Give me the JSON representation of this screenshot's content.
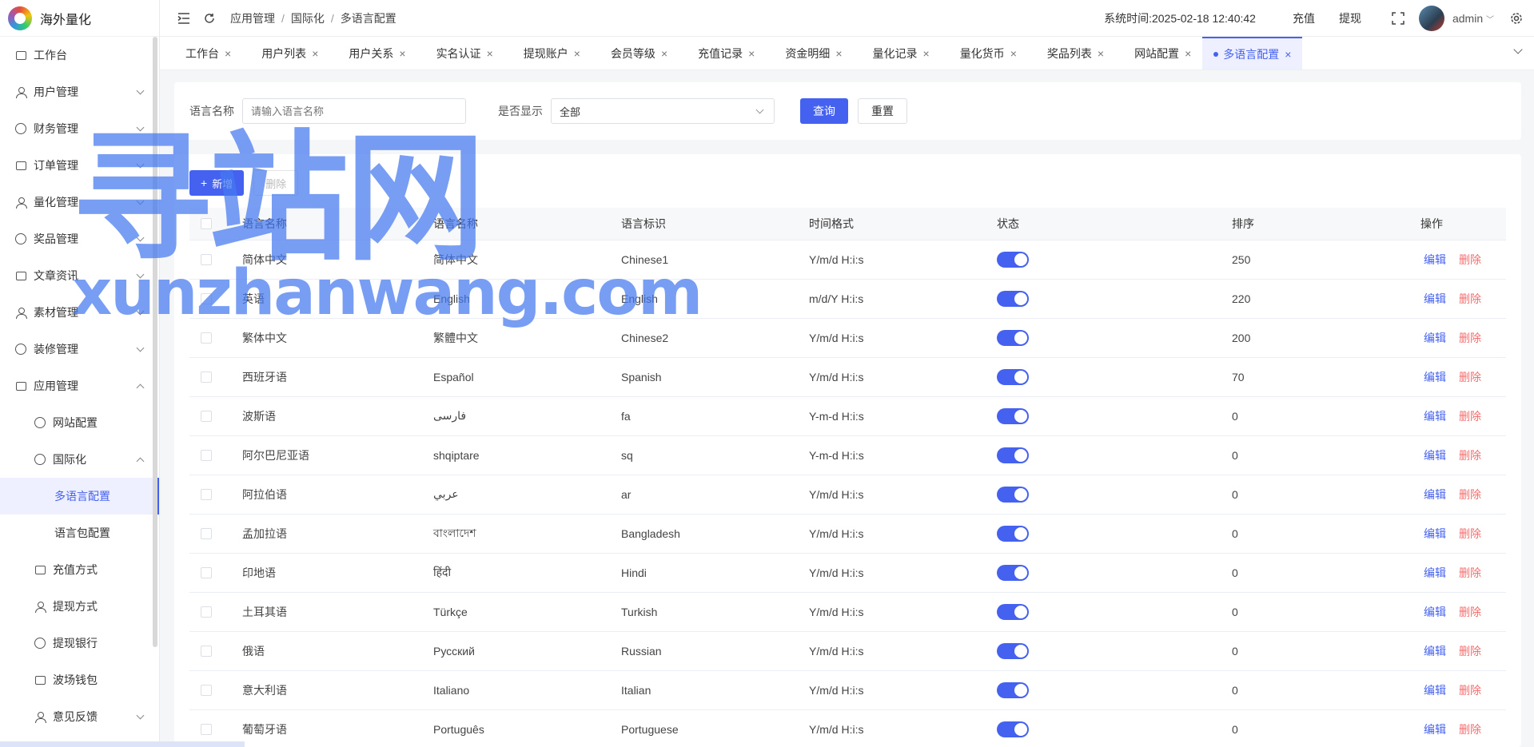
{
  "app": {
    "title": "海外量化"
  },
  "sidebar": {
    "items": [
      {
        "label": "工作台",
        "icon": "monitor-icon",
        "expandable": false
      },
      {
        "label": "用户管理",
        "icon": "user-icon",
        "expandable": true
      },
      {
        "label": "财务管理",
        "icon": "chart-icon",
        "expandable": true
      },
      {
        "label": "订单管理",
        "icon": "order-icon",
        "expandable": true
      },
      {
        "label": "量化管理",
        "icon": "quant-icon",
        "expandable": true
      },
      {
        "label": "奖品管理",
        "icon": "gift-icon",
        "expandable": true
      },
      {
        "label": "文章资讯",
        "icon": "article-icon",
        "expandable": true
      },
      {
        "label": "素材管理",
        "icon": "image-icon",
        "expandable": true
      },
      {
        "label": "装修管理",
        "icon": "decorate-icon",
        "expandable": true
      },
      {
        "label": "应用管理",
        "icon": "app-icon",
        "expandable": true,
        "expanded": true
      }
    ],
    "app_children": [
      {
        "label": "网站配置",
        "icon": "globe-icon"
      },
      {
        "label": "国际化",
        "icon": "i18n-icon",
        "expanded": true
      }
    ],
    "i18n_children": [
      {
        "label": "多语言配置",
        "active": true
      },
      {
        "label": "语言包配置"
      }
    ],
    "app_children_more": [
      {
        "label": "充值方式",
        "icon": "recharge-icon"
      },
      {
        "label": "提现方式",
        "icon": "withdraw-icon"
      },
      {
        "label": "提现银行",
        "icon": "bank-icon"
      },
      {
        "label": "波场钱包",
        "icon": "wallet-icon"
      },
      {
        "label": "意见反馈",
        "icon": "feedback-icon",
        "expandable": true
      }
    ]
  },
  "topbar": {
    "breadcrumb": [
      "应用管理",
      "国际化",
      "多语言配置"
    ],
    "sys_time_label": "系统时间:",
    "sys_time": "2025-02-18 12:40:42",
    "recharge": "充值",
    "withdraw": "提现",
    "user": "admin"
  },
  "tabs": [
    {
      "label": "工作台"
    },
    {
      "label": "用户列表"
    },
    {
      "label": "用户关系"
    },
    {
      "label": "实名认证"
    },
    {
      "label": "提现账户"
    },
    {
      "label": "会员等级"
    },
    {
      "label": "充值记录"
    },
    {
      "label": "资金明细"
    },
    {
      "label": "量化记录"
    },
    {
      "label": "量化货币"
    },
    {
      "label": "奖品列表"
    },
    {
      "label": "网站配置"
    },
    {
      "label": "多语言配置",
      "active": true
    }
  ],
  "filter": {
    "name_label": "语言名称",
    "name_placeholder": "请输入语言名称",
    "show_label": "是否显示",
    "show_value": "全部",
    "query": "查询",
    "reset": "重置"
  },
  "actions": {
    "add": "新增",
    "delete": "删除"
  },
  "table": {
    "columns": [
      "语言名称",
      "语言名称",
      "语言标识",
      "时间格式",
      "状态",
      "排序",
      "操作"
    ],
    "edit_label": "编辑",
    "delete_label": "删除",
    "rows": [
      {
        "name": "简体中文",
        "native": "简体中文",
        "code": "Chinese1",
        "format": "Y/m/d H:i:s",
        "enabled": true,
        "sort": "250"
      },
      {
        "name": "英语",
        "native": "English",
        "code": "English",
        "format": "m/d/Y H:i:s",
        "enabled": true,
        "sort": "220"
      },
      {
        "name": "繁体中文",
        "native": "繁體中文",
        "code": "Chinese2",
        "format": "Y/m/d H:i:s",
        "enabled": true,
        "sort": "200"
      },
      {
        "name": "西班牙语",
        "native": "Español",
        "code": "Spanish",
        "format": "Y/m/d H:i:s",
        "enabled": true,
        "sort": "70"
      },
      {
        "name": "波斯语",
        "native": "فارسی",
        "code": "fa",
        "format": "Y-m-d H:i:s",
        "enabled": true,
        "sort": "0"
      },
      {
        "name": "阿尔巴尼亚语",
        "native": "shqiptare",
        "code": "sq",
        "format": "Y-m-d H:i:s",
        "enabled": true,
        "sort": "0"
      },
      {
        "name": "阿拉伯语",
        "native": "عربي",
        "code": "ar",
        "format": "Y/m/d H:i:s",
        "enabled": true,
        "sort": "0"
      },
      {
        "name": "孟加拉语",
        "native": "বাংলাদেশ",
        "code": "Bangladesh",
        "format": "Y/m/d H:i:s",
        "enabled": true,
        "sort": "0"
      },
      {
        "name": "印地语",
        "native": "हिंदी",
        "code": "Hindi",
        "format": "Y/m/d H:i:s",
        "enabled": true,
        "sort": "0"
      },
      {
        "name": "土耳其语",
        "native": "Türkçe",
        "code": "Turkish",
        "format": "Y/m/d H:i:s",
        "enabled": true,
        "sort": "0"
      },
      {
        "name": "俄语",
        "native": "Русский",
        "code": "Russian",
        "format": "Y/m/d H:i:s",
        "enabled": true,
        "sort": "0"
      },
      {
        "name": "意大利语",
        "native": "Italiano",
        "code": "Italian",
        "format": "Y/m/d H:i:s",
        "enabled": true,
        "sort": "0"
      },
      {
        "name": "葡萄牙语",
        "native": "Português",
        "code": "Portuguese",
        "format": "Y/m/d H:i:s",
        "enabled": true,
        "sort": "0"
      }
    ]
  },
  "watermark": {
    "cn": "寻站网",
    "en": "xunzhanwang.com"
  },
  "colors": {
    "primary": "#4461ef",
    "danger": "#f56c6c",
    "active_bg": "#eef0ff"
  }
}
